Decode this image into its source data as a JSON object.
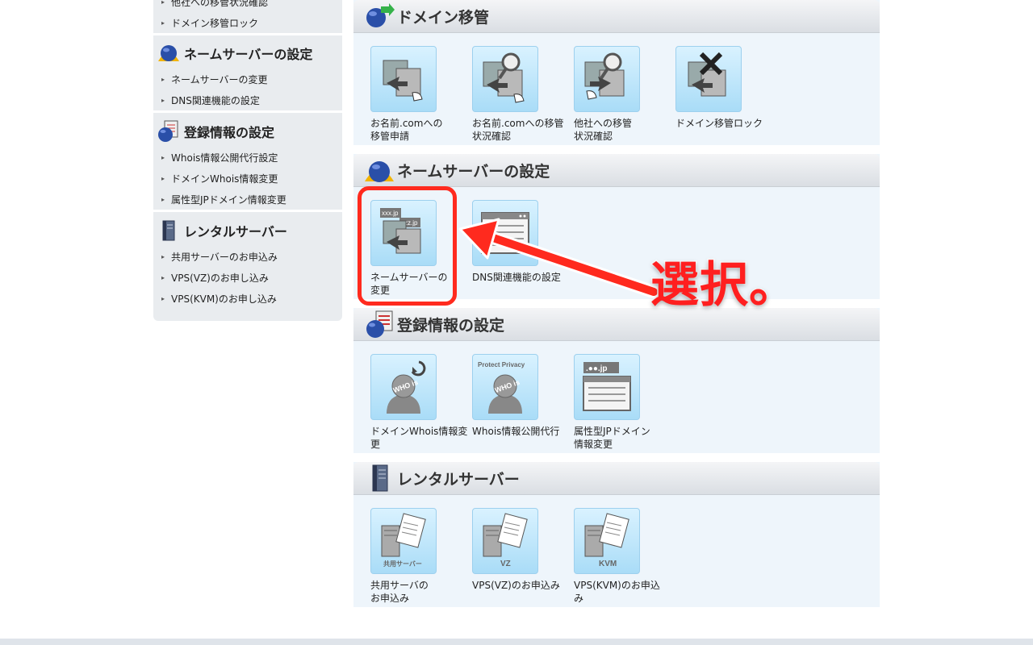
{
  "sidebar": {
    "top_links": [
      "他社への移管状況確認",
      "ドメイン移管ロック"
    ],
    "sections": [
      {
        "title": "ネームサーバーの設定",
        "icon": "nameserver-globe-icon",
        "links": [
          "ネームサーバーの変更",
          "DNS関連機能の設定"
        ]
      },
      {
        "title": "登録情報の設定",
        "icon": "registration-info-icon",
        "links": [
          "Whois情報公開代行設定",
          "ドメインWhois情報変更",
          "属性型JPドメイン情報変更"
        ]
      },
      {
        "title": "レンタルサーバー",
        "icon": "server-icon",
        "links": [
          "共用サーバーのお申込み",
          "VPS(VZ)のお申し込み",
          "VPS(KVM)のお申し込み"
        ]
      }
    ]
  },
  "panels": {
    "transfer": {
      "title": "ドメイン移管",
      "tiles": [
        {
          "label": "お名前.comへの\n移管申請",
          "icon": "transfer-request-icon"
        },
        {
          "label": "お名前.comへの移管\n状況確認",
          "icon": "transfer-status-icon"
        },
        {
          "label": "他社への移管\n状況確認",
          "icon": "outbound-transfer-status-icon"
        },
        {
          "label": "ドメイン移管ロック",
          "icon": "transfer-lock-icon"
        }
      ]
    },
    "nameserver": {
      "title": "ネームサーバーの設定",
      "tiles": [
        {
          "label": "ネームサーバーの\n変更",
          "icon": "nameserver-change-icon",
          "icon_text_1": "xxx.jp",
          "icon_text_2": "zzz.jp"
        },
        {
          "label": "DNS関連機能の設定",
          "icon": "dns-settings-icon"
        }
      ]
    },
    "registration": {
      "title": "登録情報の設定",
      "tiles": [
        {
          "label": "ドメインWhois情報変\n更",
          "icon": "whois-change-icon",
          "icon_text": "WHO is"
        },
        {
          "label": "Whois情報公開代行",
          "icon": "whois-privacy-icon",
          "icon_text": "Protect Privacy"
        },
        {
          "label": "属性型JPドメイン\n情報変更",
          "icon": "jp-domain-icon",
          "icon_text": ".●●.jp"
        }
      ]
    },
    "rental": {
      "title": "レンタルサーバー",
      "tiles": [
        {
          "label": "共用サーバの\nお申込み",
          "icon": "shared-server-icon",
          "icon_text": "共用サーバー"
        },
        {
          "label": "VPS(VZ)のお申込み",
          "icon": "vps-vz-icon",
          "icon_text": "VZ"
        },
        {
          "label": "VPS(KVM)のお申込\nみ",
          "icon": "vps-kvm-icon",
          "icon_text": "KVM"
        }
      ]
    }
  },
  "annotation": {
    "text": "選択。",
    "color": "#ff1f1f"
  }
}
